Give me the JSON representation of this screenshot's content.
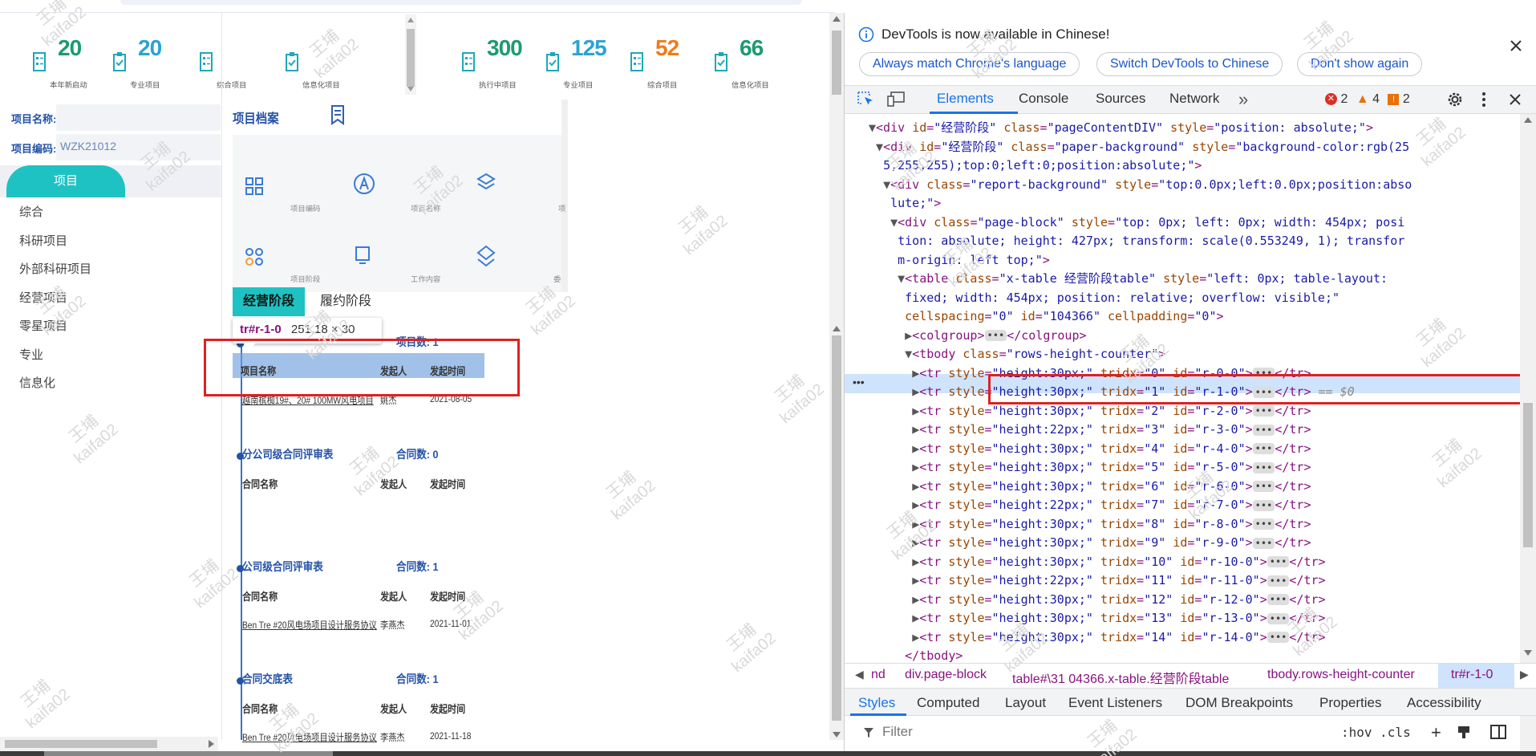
{
  "stats": [
    {
      "num": "20",
      "label": "本年新启动",
      "color": "#1b9c6e"
    },
    {
      "num": "20",
      "label": "专业项目",
      "color": "#2aa3d4"
    },
    {
      "num": "",
      "label": "综合项目",
      "color": "#2aa3d4"
    },
    {
      "num": "",
      "label": "信息化项目",
      "color": "#2aa3d4"
    },
    {
      "num": "300",
      "label": "执行中项目",
      "color": "#1b9c6e"
    },
    {
      "num": "125",
      "label": "专业项目",
      "color": "#2aa3d4"
    },
    {
      "num": "52",
      "label": "综合项目",
      "color": "#f07b1a"
    },
    {
      "num": "66",
      "label": "信息化项目",
      "color": "#1b9c6e"
    }
  ],
  "search": {
    "name_label": "项目名称:",
    "name_value": "",
    "code_label": "项目编码:",
    "code_value": "WZK21012"
  },
  "menu": {
    "active_tab": "项目",
    "items": [
      "综合",
      "科研项目",
      "外部科研项目",
      "经营项目",
      "零星项目",
      "专业",
      "信息化"
    ]
  },
  "archive": {
    "title": "项目档案",
    "tiles": [
      {
        "label": "项目编码",
        "icon": "grid-icon"
      },
      {
        "label": "项目名称",
        "icon": "letter-a-icon"
      },
      {
        "label": "项目阶段",
        "icon": "circles-icon"
      },
      {
        "label": "工作内容",
        "icon": "monitor-icon"
      }
    ],
    "cut_labels": [
      "项",
      "委"
    ]
  },
  "stage_tabs": [
    "经营阶段",
    "履约阶段"
  ],
  "inspect_tip": {
    "selector": "tr#r-1-0",
    "size": "251.18 × 30"
  },
  "sections": [
    {
      "title": "",
      "count": "项目数: 1",
      "headers": [
        "项目名称",
        "发起人",
        "发起时间"
      ],
      "rows": [
        [
          "越南槟椥19#、20# 100MW风电项目",
          "姚杰",
          "2021-08-05"
        ]
      ]
    },
    {
      "title": "分公司级合同评审表",
      "count": "合同数: 0",
      "headers": [
        "合同名称",
        "发起人",
        "发起时间"
      ],
      "rows": []
    },
    {
      "title": "公司级合同评审表",
      "count": "合同数: 1",
      "headers": [
        "合同名称",
        "发起人",
        "发起时间"
      ],
      "rows": [
        [
          "Ben Tre #20风电场项目设计服务协议",
          "李燕杰",
          "2021-11-01"
        ]
      ]
    },
    {
      "title": "合同交底表",
      "count": "合同数: 1",
      "headers": [
        "合同名称",
        "发起人",
        "发起时间"
      ],
      "rows": [
        [
          "Ben Tre #20风电场项目设计服务协议",
          "李燕杰",
          "2021-11-18"
        ]
      ]
    }
  ],
  "devtools": {
    "banner": "DevTools is now available in Chinese!",
    "btn1": "Always match Chrome's language",
    "btn2": "Switch DevTools to Chinese",
    "btn3": "Don't show again",
    "tabs": [
      "Elements",
      "Console",
      "Sources",
      "Network"
    ],
    "more": "»",
    "errors": "2",
    "warnings": "4",
    "issues": "2",
    "crumbs": [
      "nd",
      "div.page-block",
      "table#\\31 04366.x-table.经营阶段table",
      "tbody.rows-height-counter",
      "tr#r-1-0"
    ],
    "bottom_tabs": [
      "Styles",
      "Computed",
      "Layout",
      "Event Listeners",
      "DOM Breakpoints",
      "Properties",
      "Accessibility"
    ],
    "filter_placeholder": "Filter",
    "filter_tools": ":hov .cls"
  },
  "watermark": [
    "王埔",
    "kaifa02"
  ],
  "colors": {
    "accent": "#1a73e8",
    "teal": "#1fc2c2",
    "red_box": "#e02020",
    "selection": "#cfe3fc"
  }
}
